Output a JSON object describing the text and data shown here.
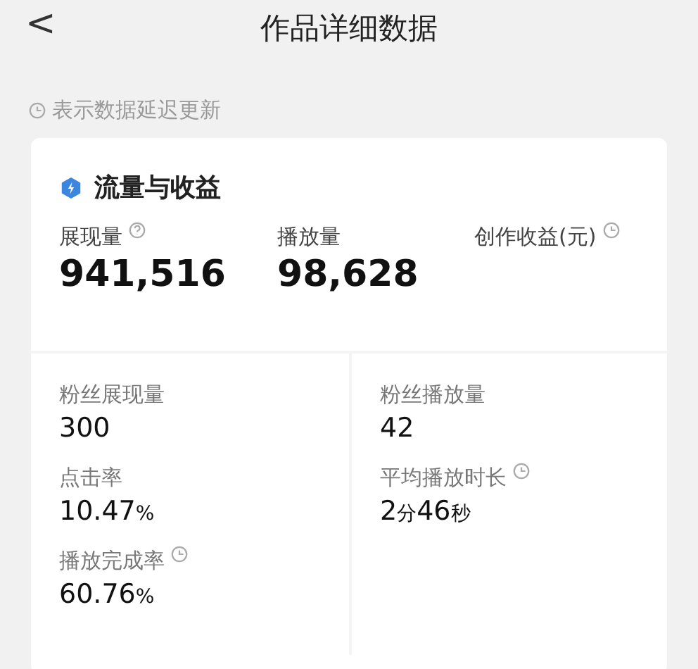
{
  "header": {
    "back_icon": "<",
    "title": "作品详细数据"
  },
  "note": {
    "text": "表示数据延迟更新"
  },
  "card": {
    "title": "流量与收益",
    "main_metrics": [
      {
        "label": "展现量",
        "help": true,
        "delayed": false,
        "parts": [
          {
            "text": "941,516",
            "kind": "num"
          }
        ]
      },
      {
        "label": "播放量",
        "help": false,
        "delayed": false,
        "parts": [
          {
            "text": "98,628",
            "kind": "num"
          }
        ]
      },
      {
        "label": "创作收益(元)",
        "help": false,
        "delayed": true
      }
    ],
    "detail_columns": [
      [
        {
          "label": "粉丝展现量",
          "delayed": false,
          "parts": [
            {
              "text": "300",
              "kind": "num"
            }
          ]
        },
        {
          "label": "点击率",
          "delayed": false,
          "parts": [
            {
              "text": "10.47",
              "kind": "num"
            },
            {
              "text": "%",
              "kind": "unit"
            }
          ]
        },
        {
          "label": "播放完成率",
          "delayed": true,
          "parts": [
            {
              "text": "60.76",
              "kind": "num"
            },
            {
              "text": "%",
              "kind": "unit"
            }
          ]
        }
      ],
      [
        {
          "label": "粉丝播放量",
          "delayed": false,
          "parts": [
            {
              "text": "42",
              "kind": "num"
            }
          ]
        },
        {
          "label": "平均播放时长",
          "delayed": true,
          "parts": [
            {
              "text": "2",
              "kind": "num"
            },
            {
              "text": "分",
              "kind": "unit"
            },
            {
              "text": "46",
              "kind": "num"
            },
            {
              "text": "秒",
              "kind": "unit"
            }
          ]
        }
      ]
    ]
  }
}
